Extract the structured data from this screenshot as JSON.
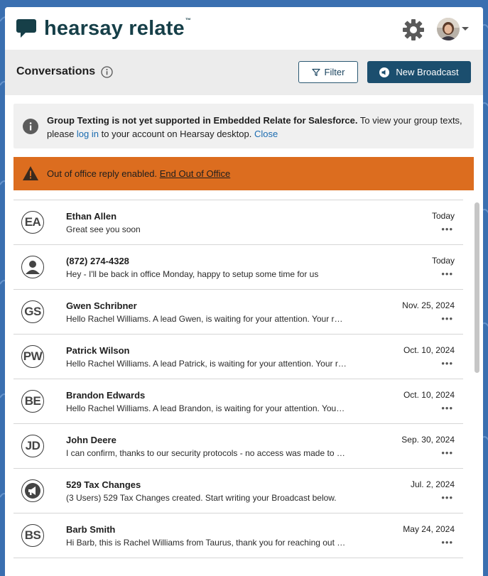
{
  "app": {
    "logo_text": "hearsay relate",
    "logo_tm": "™"
  },
  "header": {
    "title": "Conversations",
    "filter_label": "Filter",
    "broadcast_label": "New Broadcast"
  },
  "info_banner": {
    "bold": "Group Texting is not yet supported in Embedded Relate for Salesforce.",
    "text1": " To view your group texts, please ",
    "link": "log in",
    "text2": " to your account on Hearsay desktop. ",
    "close": "Close"
  },
  "ooo_banner": {
    "text": "Out of office reply enabled. ",
    "link": "End Out of Office"
  },
  "conversations": [
    {
      "avatar_type": "initials",
      "initials": "EA",
      "name": "Ethan Allen",
      "preview": "Great see you soon",
      "date": "Today",
      "menu": "•••"
    },
    {
      "avatar_type": "person-icon",
      "initials": "",
      "name": "(872) 274-4328",
      "preview": "Hey - I'll be back in office Monday, happy to setup some time for us",
      "date": "Today",
      "menu": "•••"
    },
    {
      "avatar_type": "initials",
      "initials": "GS",
      "name": "Gwen Schribner",
      "preview": "Hello Rachel Williams. A lead Gwen, is waiting for your attention. Your response is needed.",
      "date": "Nov. 25, 2024",
      "menu": "•••"
    },
    {
      "avatar_type": "initials",
      "initials": "PW",
      "name": "Patrick Wilson",
      "preview": "Hello Rachel Williams. A lead Patrick, is waiting for your attention. Your response is needed.",
      "date": "Oct. 10, 2024",
      "menu": "•••"
    },
    {
      "avatar_type": "initials",
      "initials": "BE",
      "name": "Brandon Edwards",
      "preview": "Hello Rachel Williams. A lead Brandon, is waiting for your attention. Your response is needed.",
      "date": "Oct. 10, 2024",
      "menu": "•••"
    },
    {
      "avatar_type": "initials",
      "initials": "JD",
      "name": "John Deere",
      "preview": "I can confirm, thanks to our security protocols - no access was made to your account.",
      "date": "Sep. 30, 2024",
      "menu": "•••"
    },
    {
      "avatar_type": "broadcast-icon",
      "initials": "",
      "name": "529 Tax Changes",
      "preview": "(3 Users) 529 Tax Changes created. Start writing your Broadcast below.",
      "date": "Jul. 2, 2024",
      "menu": "•••"
    },
    {
      "avatar_type": "initials",
      "initials": "BS",
      "name": "Barb Smith",
      "preview": "Hi Barb, this is Rachel Williams from Taurus, thank you for reaching out to us today.",
      "date": "May 24, 2024",
      "menu": "•••"
    }
  ],
  "colors": {
    "brand": "#163f48",
    "primary_button": "#1b4e6e",
    "warning": "#dc6d1f",
    "link": "#1a6bb0"
  }
}
